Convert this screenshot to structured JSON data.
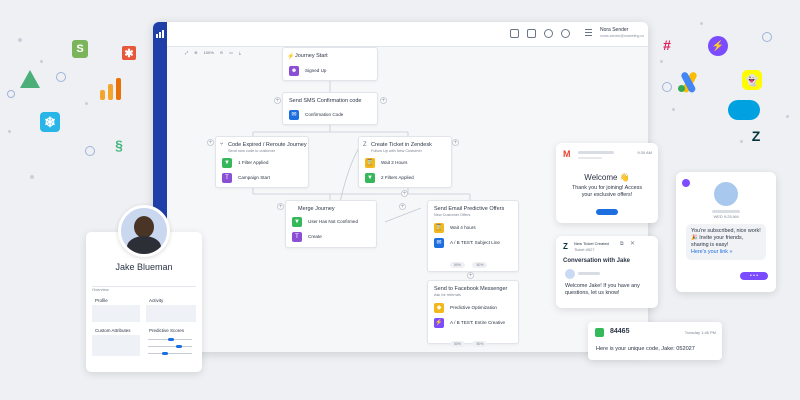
{
  "colors": {
    "brand": "#1f3fa8",
    "accent_blue": "#1d6fe0",
    "yellow": "#f2b81b",
    "green": "#35b85a",
    "purple": "#8b4fd6",
    "background": "#eef0f4"
  },
  "app": {
    "user_name": "Nora Sender",
    "user_email": "noras.sender@marketing.co",
    "zoom": "100%",
    "header_icons": [
      "grid-icon",
      "chat-icon",
      "help-icon",
      "gear-icon",
      "menu-icon"
    ]
  },
  "flow": {
    "journey_start": {
      "title": "Journey Start",
      "step": "Signed Up"
    },
    "sms": {
      "title": "Send SMS Confirmation code",
      "step": "Confirmation Code"
    },
    "code_expired": {
      "title": "Code Expired / Reroute Journey",
      "subtitle": "Send new code to customer",
      "steps": [
        "1 Filter Applied",
        "Campaign Start"
      ]
    },
    "zendesk": {
      "title": "Create Ticket in Zendesk",
      "subtitle": "Follow Up with New Customer",
      "steps": [
        "Wait 2 Hours",
        "2 Filters Applied"
      ]
    },
    "merge": {
      "title": "Merge Journey",
      "steps": [
        "User Has Not Confirmed",
        "Create"
      ]
    },
    "email": {
      "title": "Send Email Predictive Offers",
      "subtitle": "New Customer Offers",
      "steps": [
        "Wait 4 hours",
        "A / B TEST: Subject Line"
      ],
      "pills": [
        "50%",
        "50%"
      ]
    },
    "facebook": {
      "title": "Send to Facebook Messenger",
      "subtitle": "Ask for referrals",
      "steps": [
        "Predictive Optimization",
        "A / B TEST: Entire Creative"
      ],
      "pills": [
        "50%",
        "50%"
      ]
    }
  },
  "profile": {
    "name": "Jake Blueman",
    "tabs": [
      "Overview"
    ],
    "sections": [
      "Profile",
      "Activity",
      "Custom Attributes",
      "Predictive Scores"
    ]
  },
  "gmail": {
    "time": "9:30 AM",
    "heading": "Welcome 👋",
    "body": "Thank you for joining! Access your exclusive offers!"
  },
  "zendesk_ticket": {
    "title": "New Ticket Created",
    "ticket": "Ticket #527",
    "heading": "Conversation with Jake",
    "body": "Welcome Jake! If you have any questions, let us know!"
  },
  "messenger": {
    "date": "WED 9:25 AM",
    "body": "You're subscribed, nice work! 🎉 Invite your friends, sharing is easy!",
    "link": "Here's your link »"
  },
  "sms": {
    "number": "84465",
    "time": "Tuesday 1:46 PM",
    "body": "Here is your unique code, Jake:",
    "code": "052027"
  }
}
